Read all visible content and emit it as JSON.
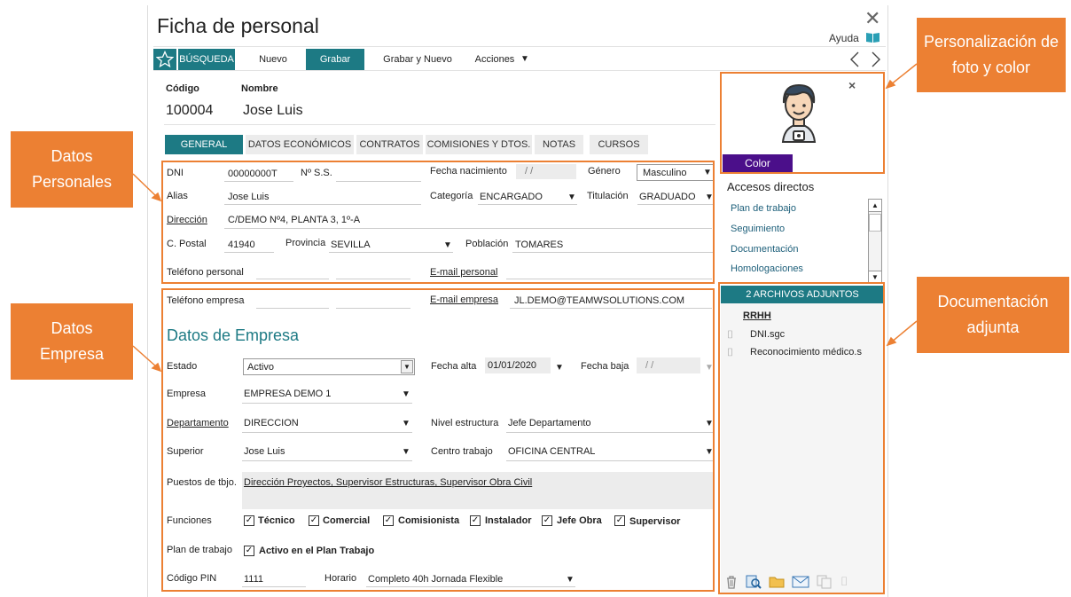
{
  "window": {
    "title": "Ficha de personal",
    "help_label": "Ayuda"
  },
  "toolbar": {
    "search_label": "BÚSQUEDA",
    "new_label": "Nuevo",
    "save_label": "Grabar",
    "save_new_label": "Grabar y Nuevo",
    "actions_label": "Acciones"
  },
  "header": {
    "code_label": "Código",
    "code_value": "100004",
    "name_label": "Nombre",
    "name_value": "Jose Luis"
  },
  "tabs": [
    "GENERAL",
    "DATOS ECONÓMICOS",
    "CONTRATOS",
    "COMISIONES Y DTOS.",
    "NOTAS",
    "CURSOS"
  ],
  "personal": {
    "dni_label": "DNI",
    "dni_value": "00000000T",
    "nss_label": "Nº S.S.",
    "birth_label": "Fecha nacimiento",
    "birth_value": "/ /",
    "gender_label": "Género",
    "gender_value": "Masculino",
    "alias_label": "Alias",
    "alias_value": "Jose Luis",
    "category_label": "Categoría",
    "category_value": "ENCARGADO",
    "degree_label": "Titulación",
    "degree_value": "GRADUADO",
    "address_label": "Dirección",
    "address_value": "C/DEMO Nº4, PLANTA 3, 1º-A",
    "zip_label": "C. Postal",
    "zip_value": "41940",
    "province_label": "Provincia",
    "province_value": "SEVILLA",
    "town_label": "Población",
    "town_value": "TOMARES",
    "phone_label": "Teléfono personal",
    "email_label": "E-mail personal"
  },
  "company": {
    "phone_label": "Teléfono empresa",
    "email_label": "E-mail empresa",
    "email_value": "JL.DEMO@TEAMWSOLUTIONS.COM",
    "section_title": "Datos de Empresa",
    "status_label": "Estado",
    "status_value": "Activo",
    "start_label": "Fecha alta",
    "start_value": "01/01/2020",
    "end_label": "Fecha baja",
    "end_value": "/ /",
    "company_label": "Empresa",
    "company_value": "EMPRESA DEMO 1",
    "dept_label": "Departamento",
    "dept_value": "DIRECCION",
    "level_label": "Nivel estructura",
    "level_value": "Jefe Departamento",
    "boss_label": "Superior",
    "boss_value": "Jose Luis",
    "center_label": "Centro trabajo",
    "center_value": "OFICINA CENTRAL",
    "posts_label": "Puestos de tbjo.",
    "posts_value": "Dirección Proyectos, Supervisor Estructuras, Supervisor Obra Civil",
    "functions_label": "Funciones",
    "functions": [
      "Técnico",
      "Comercial",
      "Comisionista",
      "Instalador",
      "Jefe Obra",
      "Supervisor"
    ],
    "plan_label": "Plan de trabajo",
    "plan_value": "Activo en el Plan Trabajo",
    "pin_label": "Código PIN",
    "pin_value": "1111",
    "schedule_label": "Horario",
    "schedule_value": "Completo 40h Jornada Flexible"
  },
  "side": {
    "photo_close": "×",
    "color_label": "Color",
    "shortcuts_title": "Accesos directos",
    "shortcuts": [
      "Plan de trabajo",
      "Seguimiento",
      "Documentación",
      "Homologaciones"
    ],
    "attach_header": "2 ARCHIVOS ADJUNTOS",
    "attach_group": "RRHH",
    "attachments": [
      "DNI.sgc",
      "Reconocimiento médico.s"
    ]
  },
  "callouts": {
    "photo": "Personalización de foto y color",
    "personal": "Datos Personales",
    "company": "Datos Empresa",
    "docs": "Documentación adjunta"
  },
  "colors": {
    "accent": "#1d7a84",
    "callout": "#ec8033",
    "color_button": "#4b0f8a"
  },
  "icons": [
    "star-icon",
    "book-icon",
    "caret-down-icon",
    "chevron-left-icon",
    "chevron-right-icon",
    "close-icon",
    "avatar-icon",
    "paperclip-icon",
    "trash-icon",
    "search-doc-icon",
    "folder-icon",
    "mail-icon",
    "copy-icon"
  ]
}
